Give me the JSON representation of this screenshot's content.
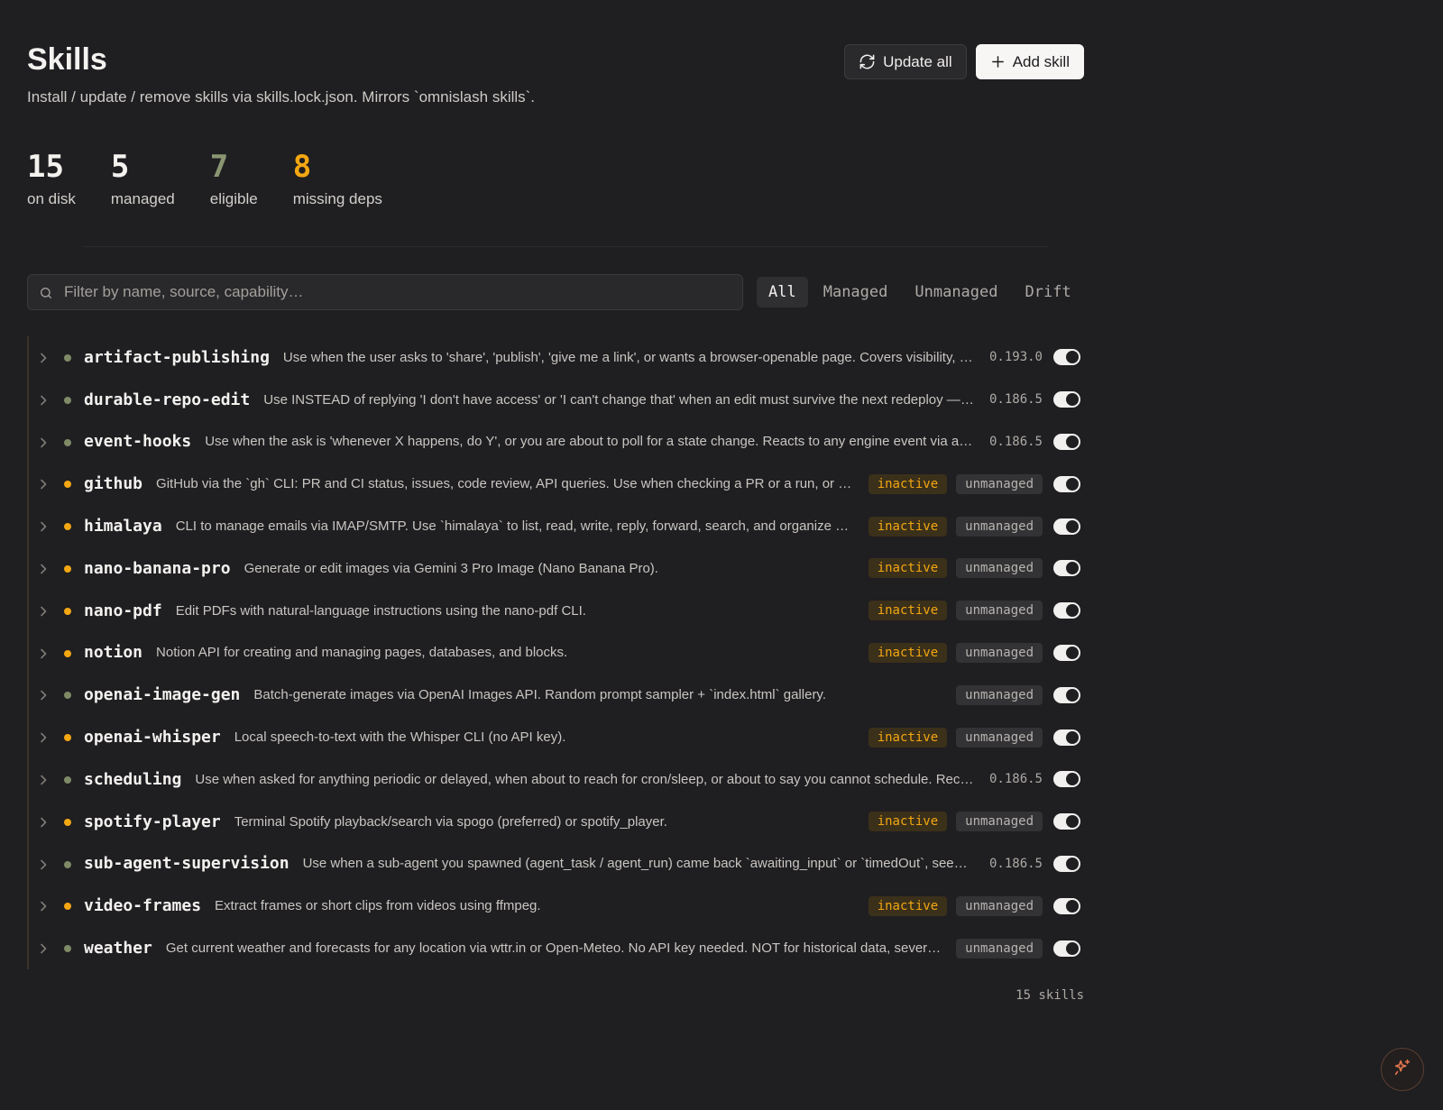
{
  "page": {
    "title": "Skills",
    "subtitle": "Install / update / remove skills via skills.lock.json. Mirrors `omnislash skills`."
  },
  "actions": {
    "update_all_label": "Update all",
    "add_skill_label": "Add skill"
  },
  "stats": [
    {
      "value": "15",
      "label": "on disk",
      "color": "#f4f2ef"
    },
    {
      "value": "5",
      "label": "managed",
      "color": "#f4f2ef"
    },
    {
      "value": "7",
      "label": "eligible",
      "color": "#8a9672"
    },
    {
      "value": "8",
      "label": "missing deps",
      "color": "#f3a712"
    }
  ],
  "search": {
    "placeholder": "Filter by name, source, capability…",
    "value": ""
  },
  "tabs": [
    {
      "label": "All",
      "active": true
    },
    {
      "label": "Managed",
      "active": false
    },
    {
      "label": "Unmanaged",
      "active": false
    },
    {
      "label": "Drift",
      "active": false
    }
  ],
  "colors": {
    "ok_dot": "#7f8a66",
    "warn_dot": "#f3a712",
    "accent_orange": "#f3a712"
  },
  "skills": [
    {
      "name": "artifact-publishing",
      "desc": "Use when the user asks to 'share', 'publish', 'give me a link', or wants a browser-openable page. Covers visibility, ex…",
      "status": "ok",
      "version": "0.193.0",
      "inactive": "",
      "managed_badge": "",
      "enabled": true
    },
    {
      "name": "durable-repo-edit",
      "desc": "Use INSTEAD of replying 'I don't have access' or 'I can't change that' when an edit must survive the next redeploy — co…",
      "status": "ok",
      "version": "0.186.5",
      "inactive": "",
      "managed_badge": "",
      "enabled": true
    },
    {
      "name": "event-hooks",
      "desc": "Use when the ask is 'whenever X happens, do Y', or you are about to poll for a state change. Reacts to any engine event via a `*.…",
      "status": "ok",
      "version": "0.186.5",
      "inactive": "",
      "managed_badge": "",
      "enabled": true
    },
    {
      "name": "github",
      "desc": "GitHub via the `gh` CLI: PR and CI status, issues, code review, API queries. Use when checking a PR or a run, or c…",
      "status": "warn",
      "version": "",
      "inactive": "inactive",
      "managed_badge": "unmanaged",
      "enabled": true
    },
    {
      "name": "himalaya",
      "desc": "CLI to manage emails via IMAP/SMTP. Use `himalaya` to list, read, write, reply, forward, search, and organize e…",
      "status": "warn",
      "version": "",
      "inactive": "inactive",
      "managed_badge": "unmanaged",
      "enabled": true
    },
    {
      "name": "nano-banana-pro",
      "desc": "Generate or edit images via Gemini 3 Pro Image (Nano Banana Pro).",
      "status": "warn",
      "version": "",
      "inactive": "inactive",
      "managed_badge": "unmanaged",
      "enabled": true
    },
    {
      "name": "nano-pdf",
      "desc": "Edit PDFs with natural-language instructions using the nano-pdf CLI.",
      "status": "warn",
      "version": "",
      "inactive": "inactive",
      "managed_badge": "unmanaged",
      "enabled": true
    },
    {
      "name": "notion",
      "desc": "Notion API for creating and managing pages, databases, and blocks.",
      "status": "warn",
      "version": "",
      "inactive": "inactive",
      "managed_badge": "unmanaged",
      "enabled": true
    },
    {
      "name": "openai-image-gen",
      "desc": "Batch-generate images via OpenAI Images API. Random prompt sampler + `index.html` gallery.",
      "status": "ok",
      "version": "",
      "inactive": "",
      "managed_badge": "unmanaged",
      "enabled": true
    },
    {
      "name": "openai-whisper",
      "desc": "Local speech-to-text with the Whisper CLI (no API key).",
      "status": "warn",
      "version": "",
      "inactive": "inactive",
      "managed_badge": "unmanaged",
      "enabled": true
    },
    {
      "name": "scheduling",
      "desc": "Use when asked for anything periodic or delayed, when about to reach for cron/sleep, or about to say you cannot schedule. Recurr…",
      "status": "ok",
      "version": "0.186.5",
      "inactive": "",
      "managed_badge": "",
      "enabled": true
    },
    {
      "name": "spotify-player",
      "desc": "Terminal Spotify playback/search via spogo (preferred) or spotify_player.",
      "status": "warn",
      "version": "",
      "inactive": "inactive",
      "managed_badge": "unmanaged",
      "enabled": true
    },
    {
      "name": "sub-agent-supervision",
      "desc": "Use when a sub-agent you spawned (agent_task / agent_run) came back `awaiting_input` or `timedOut`, seems …",
      "status": "ok",
      "version": "0.186.5",
      "inactive": "",
      "managed_badge": "",
      "enabled": true
    },
    {
      "name": "video-frames",
      "desc": "Extract frames or short clips from videos using ffmpeg.",
      "status": "warn",
      "version": "",
      "inactive": "inactive",
      "managed_badge": "unmanaged",
      "enabled": true
    },
    {
      "name": "weather",
      "desc": "Get current weather and forecasts for any location via wttr.in or Open-Meteo. No API key needed. NOT for historical data, severe-…",
      "status": "ok",
      "version": "",
      "inactive": "",
      "managed_badge": "unmanaged",
      "enabled": true
    }
  ],
  "footer": {
    "count_label": "15 skills"
  },
  "icons": {
    "update_all": "refresh-icon",
    "add_skill": "plus-icon",
    "search": "search-icon",
    "row_expand": "chevron-right-icon",
    "assistant_fab": "sparkle-icon"
  }
}
